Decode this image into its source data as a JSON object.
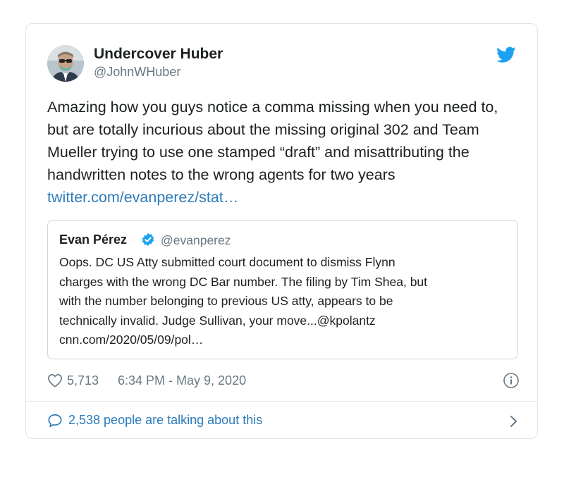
{
  "author": {
    "name": "Undercover Huber",
    "handle": "@JohnWHuber"
  },
  "tweet": {
    "text": "Amazing how you guys notice a comma missing when you need to, but are totally incurious about the missing original 302 and Team Mueller trying to use one stamped “draft” and misattributing the handwritten notes to the wrong agents for two years ",
    "link_text": "twitter.com/evanperez/stat…"
  },
  "quoted_tweet": {
    "name": "Evan Pérez",
    "handle": "@evanperez",
    "lines": [
      "Oops. DC US Atty submitted court document to dismiss Flynn",
      "charges with the wrong DC Bar number. The filing by Tim Shea, but",
      "with the number belonging to previous US atty, appears to be",
      "technically invalid. Judge Sullivan, your move...@kpolantz",
      "cnn.com/2020/05/09/pol…"
    ]
  },
  "meta": {
    "likes": "5,713",
    "timestamp": "6:34 PM - May 9, 2020"
  },
  "footer": {
    "talking": "2,538 people are talking about this"
  },
  "icons": {
    "bird": "twitter-bird-icon",
    "verified": "verified-badge-icon",
    "heart": "heart-icon",
    "info": "info-icon",
    "bubble": "speech-bubble-icon",
    "chevron": "chevron-right-icon"
  },
  "colors": {
    "link": "#2b7bb9",
    "twitter_blue": "#1da1f2",
    "muted": "#697882",
    "border": "#dfe3e7"
  }
}
